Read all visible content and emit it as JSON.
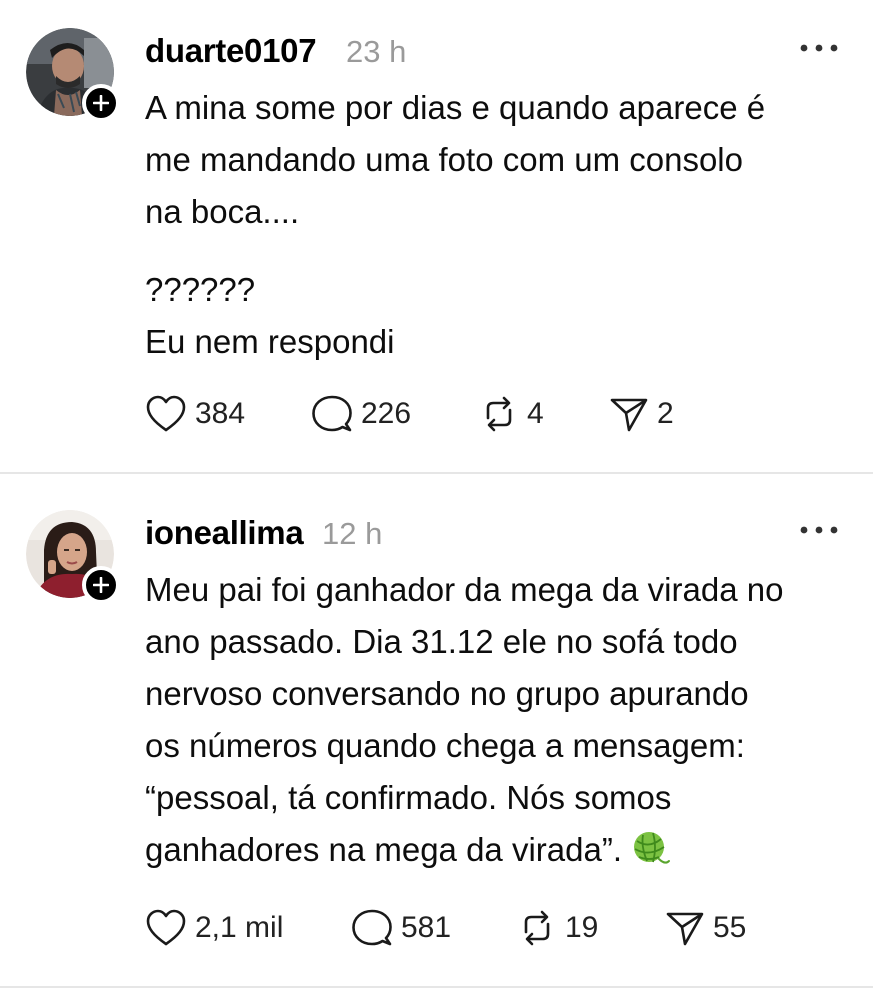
{
  "posts": [
    {
      "username": "duarte0107",
      "time": "23 h",
      "avatar_icon": "user-photo-avatar",
      "lines": [
        "A mina some por dias e quando aparece é",
        "me mandando uma foto com um consolo",
        "na boca....",
        "",
        "??????",
        "Eu nem respondi"
      ],
      "likes": "384",
      "replies": "226",
      "reposts": "4",
      "shares": "2"
    },
    {
      "username": "ioneallima",
      "time": "12 h",
      "avatar_icon": "user-photo-avatar",
      "lines": [
        "Meu pai foi ganhador da mega da virada no",
        "ano passado. Dia 31.12 ele no sofá todo",
        "nervoso conversando no grupo apurando",
        "os números quando chega a mensagem:",
        "“pessoal, tá confirmado. Nós somos",
        "ganhadores na mega da virada”."
      ],
      "emoji": "yarn-ball-emoji",
      "likes": "2,1 mil",
      "replies": "581",
      "reposts": "19",
      "shares": "55"
    }
  ],
  "colors": {
    "text": "#0d0d0d",
    "muted": "#9a9a9a",
    "divider": "#e6e6e6",
    "badge": "#000000"
  }
}
